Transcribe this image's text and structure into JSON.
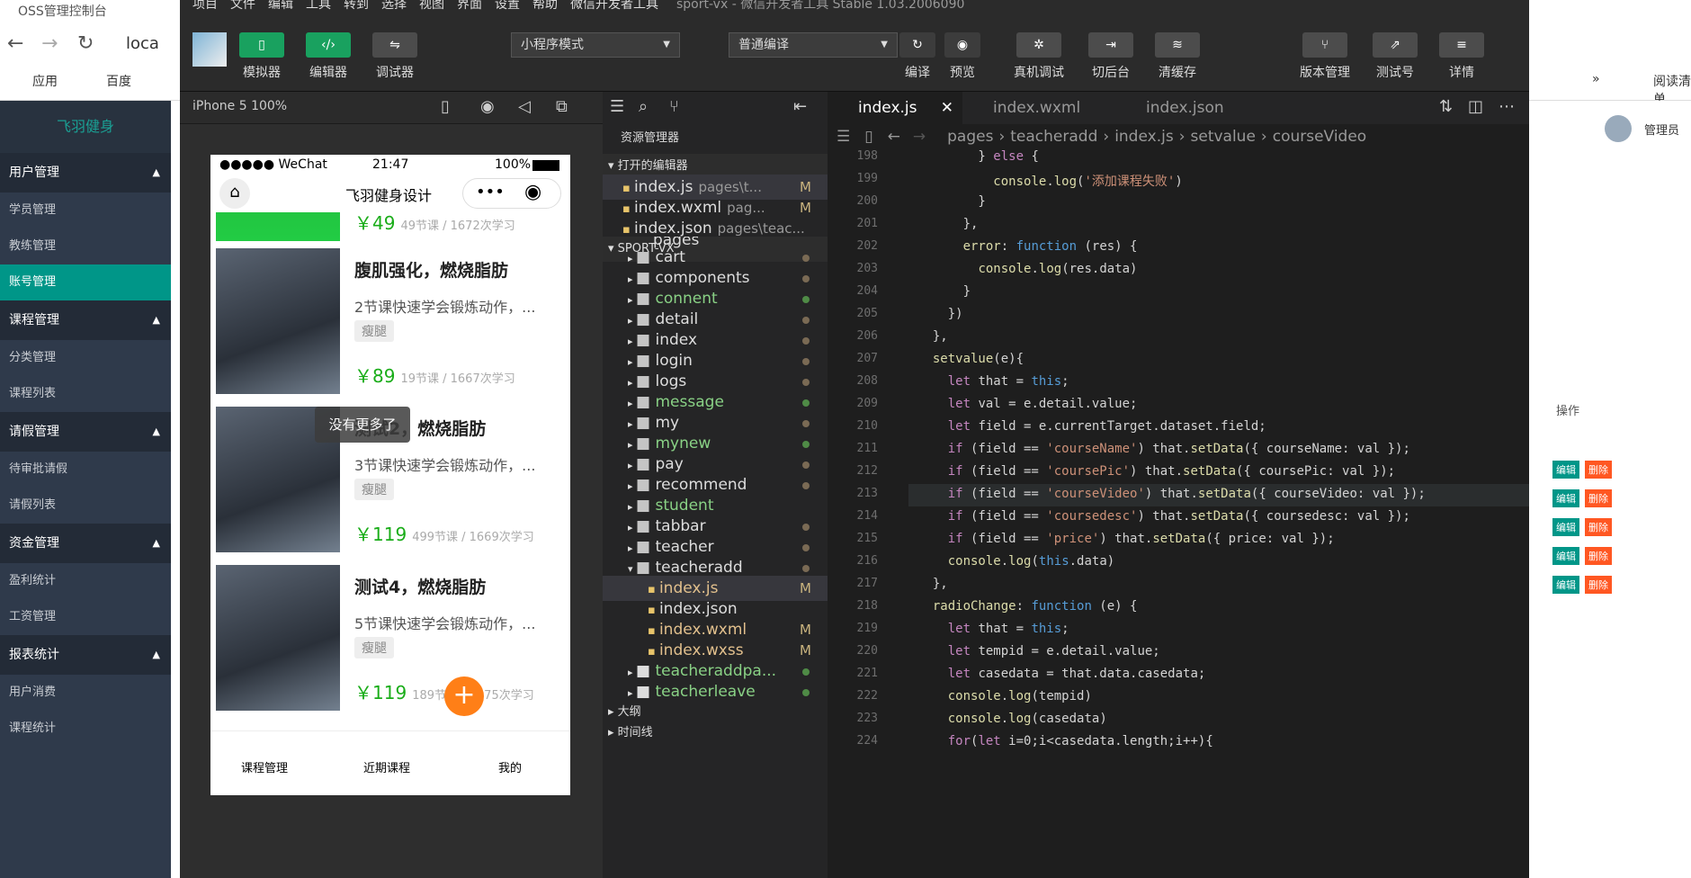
{
  "browser": {
    "tab_title": "OSS管理控制台",
    "url": "loca",
    "bookmarks": [
      "应用",
      "百度"
    ],
    "reader": "阅读清单",
    "more": "»"
  },
  "admin": {
    "brand": "飞羽健身",
    "user": "管理员",
    "groups": [
      {
        "label": "用户管理",
        "items": [
          "学员管理",
          "教练管理",
          "账号管理"
        ]
      },
      {
        "label": "课程管理",
        "items": [
          "分类管理",
          "课程列表"
        ]
      },
      {
        "label": "请假管理",
        "items": [
          "待审批请假",
          "请假列表"
        ]
      },
      {
        "label": "资金管理",
        "items": [
          "盈利统计",
          "工资管理"
        ]
      },
      {
        "label": "报表统计",
        "items": [
          "用户消费",
          "课程统计"
        ]
      }
    ],
    "active_item": "账号管理",
    "table_header": "操作",
    "edit": "编辑",
    "del": "删除"
  },
  "ide": {
    "title": "sport-vx - 微信开发者工具 Stable 1.03.2006090",
    "menu": [
      "项目",
      "文件",
      "编辑",
      "工具",
      "转到",
      "选择",
      "视图",
      "界面",
      "设置",
      "帮助",
      "微信开发者工具"
    ],
    "toolbar": {
      "simulator": "模拟器",
      "editor": "编辑器",
      "debugger": "调试器",
      "mode": "小程序模式",
      "compile_mode": "普通编译",
      "compile": "编译",
      "preview": "预览",
      "real_debug": "真机调试",
      "backstage": "切后台",
      "clear_cache": "清缓存",
      "version": "版本管理",
      "test_no": "测试号",
      "details": "详情"
    },
    "device": "iPhone 5 100%",
    "phone": {
      "carrier": "●●●●● WeChat",
      "time": "21:47",
      "battery": "100%",
      "page_title": "飞羽健身设计",
      "courses": [
        {
          "title": "",
          "desc": "",
          "tag": "",
          "price": "￥49",
          "meta": "49节课 / 1672次学习"
        },
        {
          "title": "腹肌强化，燃烧脂肪",
          "desc": "2节课快速学会锻炼动作，...",
          "tag": "瘦腿",
          "price": "￥89",
          "meta": "19节课 / 1667次学习"
        },
        {
          "title": "测试2，燃烧脂肪",
          "desc": "3节课快速学会锻炼动作，...",
          "tag": "瘦腿",
          "price": "￥119",
          "meta": "499节课 / 1669次学习"
        },
        {
          "title": "测试4，燃烧脂肪",
          "desc": "5节课快速学会锻炼动作，...",
          "tag": "瘦腿",
          "price": "￥119",
          "meta": "189节课 / 1675次学习"
        }
      ],
      "toast": "没有更多了",
      "fab": "+",
      "tabbar": [
        "课程管理",
        "近期课程",
        "我的"
      ]
    },
    "explorer": {
      "header": "资源管理器",
      "open_editors": "打开的编辑器",
      "open_files": [
        {
          "name": "index.js",
          "path": "pages\\t...",
          "mark": "M"
        },
        {
          "name": "index.wxml",
          "path": "pag...",
          "mark": "M"
        },
        {
          "name": "index.json",
          "path": "pages\\teac...",
          "mark": ""
        }
      ],
      "project": "SPORT-VX",
      "pages_folder": "pages",
      "folders": [
        "cart",
        "components",
        "connent",
        "detail",
        "index",
        "login",
        "logs",
        "message",
        "my",
        "mynew",
        "pay",
        "recommend",
        "student",
        "tabbar",
        "teacher",
        "teacheradd"
      ],
      "teacheradd_files": [
        {
          "name": "index.js",
          "mark": "M"
        },
        {
          "name": "index.json",
          "mark": ""
        },
        {
          "name": "index.wxml",
          "mark": "M"
        },
        {
          "name": "index.wxss",
          "mark": "M"
        }
      ],
      "folders_after": [
        "teacheraddpa...",
        "teacherleave"
      ],
      "outline": "大纲",
      "timeline": "时间线"
    },
    "tabs": [
      "index.js",
      "index.wxml",
      "index.json"
    ],
    "breadcrumb": [
      "pages",
      "teacheradd",
      "index.js",
      "setvalue",
      "courseVideo"
    ],
    "code": [
      {
        "n": "198",
        "t": "        } else {"
      },
      {
        "n": "199",
        "t": "          console.log('添加课程失败')"
      },
      {
        "n": "200",
        "t": "        }"
      },
      {
        "n": "201",
        "t": "      },"
      },
      {
        "n": "202",
        "t": "      error: function (res) {"
      },
      {
        "n": "203",
        "t": "        console.log(res.data)"
      },
      {
        "n": "204",
        "t": "      }"
      },
      {
        "n": "205",
        "t": "    })"
      },
      {
        "n": "206",
        "t": "  },"
      },
      {
        "n": "207",
        "t": "  setvalue(e){"
      },
      {
        "n": "208",
        "t": "    let that = this;"
      },
      {
        "n": "209",
        "t": "    let val = e.detail.value;"
      },
      {
        "n": "210",
        "t": "    let field = e.currentTarget.dataset.field;"
      },
      {
        "n": "211",
        "t": "    if (field == 'courseName') that.setData({ courseName: val });"
      },
      {
        "n": "212",
        "t": "    if (field == 'coursePic') that.setData({ coursePic: val });"
      },
      {
        "n": "213",
        "t": "    if (field == 'courseVideo') that.setData({ courseVideo: val });"
      },
      {
        "n": "214",
        "t": "    if (field == 'coursedesc') that.setData({ coursedesc: val });"
      },
      {
        "n": "215",
        "t": "    if (field == 'price') that.setData({ price: val });"
      },
      {
        "n": "216",
        "t": "    console.log(this.data)"
      },
      {
        "n": "217",
        "t": "  },"
      },
      {
        "n": "218",
        "t": "  radioChange: function (e) {"
      },
      {
        "n": "219",
        "t": "    let that = this;"
      },
      {
        "n": "220",
        "t": "    let tempid = e.detail.value;"
      },
      {
        "n": "221",
        "t": "    let casedata = that.data.casedata;"
      },
      {
        "n": "222",
        "t": "    console.log(tempid)"
      },
      {
        "n": "223",
        "t": "    console.log(casedata)"
      },
      {
        "n": "224",
        "t": "    for(let i=0;i<casedata.length;i++){"
      }
    ]
  }
}
